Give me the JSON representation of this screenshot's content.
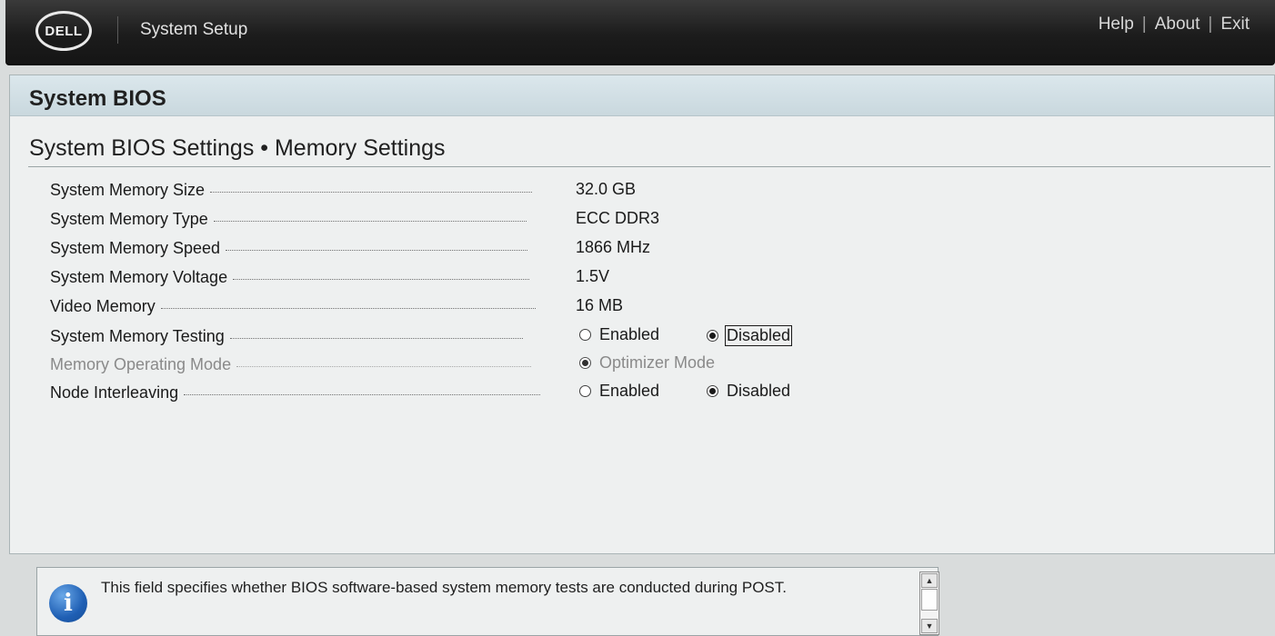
{
  "header": {
    "logo_text": "DELL",
    "app_title": "System Setup",
    "nav": {
      "help": "Help",
      "about": "About",
      "exit": "Exit",
      "separator": "|"
    }
  },
  "panel": {
    "title": "System BIOS",
    "section_title": "System BIOS Settings • Memory Settings"
  },
  "settings": [
    {
      "label": "System Memory Size",
      "value": "32.0 GB"
    },
    {
      "label": "System Memory Type",
      "value": "ECC DDR3"
    },
    {
      "label": "System Memory Speed",
      "value": "1866 MHz"
    },
    {
      "label": "System Memory Voltage",
      "value": "1.5V"
    },
    {
      "label": "Video Memory",
      "value": "16 MB"
    },
    {
      "label": "System Memory Testing",
      "options": [
        "Enabled",
        "Disabled"
      ],
      "selected": "Disabled"
    },
    {
      "label": "Memory Operating Mode",
      "options": [
        "Optimizer Mode"
      ],
      "selected": "Optimizer Mode",
      "disabled": true
    },
    {
      "label": "Node Interleaving",
      "options": [
        "Enabled",
        "Disabled"
      ],
      "selected": "Disabled"
    }
  ],
  "help": {
    "icon": "info-icon",
    "text": "This field specifies whether BIOS software-based system memory tests are conducted during POST."
  },
  "colors": {
    "header_bg": "#1c1c1c",
    "panel_header_bg": "#c9d8de",
    "panel_bg": "#eef0f0",
    "info_blue": "#1f5fb4"
  }
}
